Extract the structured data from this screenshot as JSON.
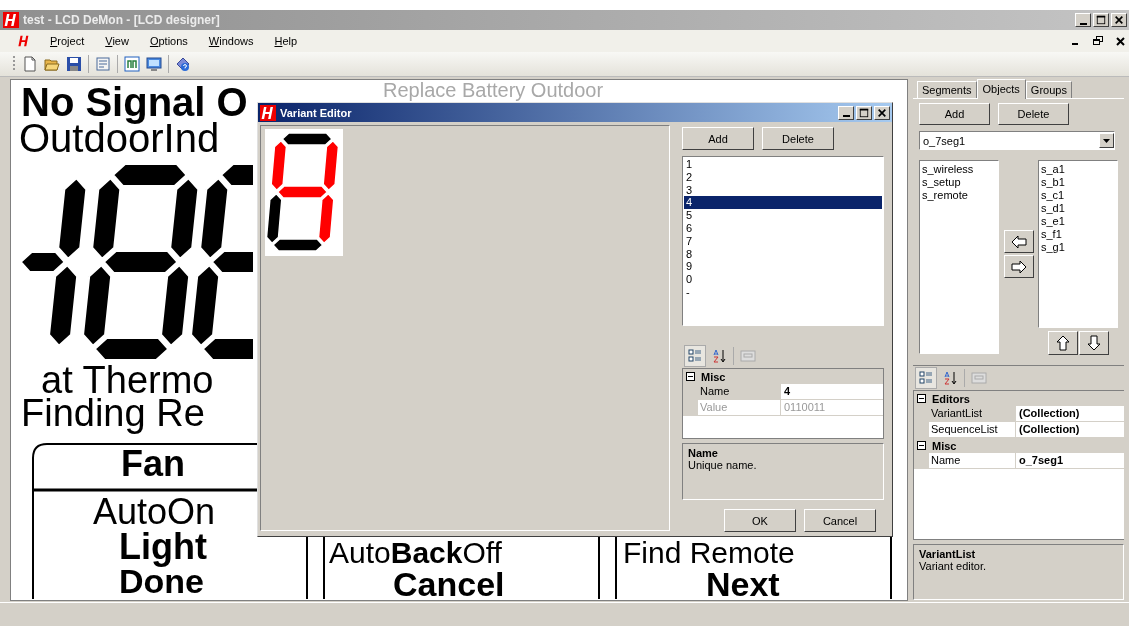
{
  "window": {
    "title": "test - LCD DeMon - [LCD designer]"
  },
  "menu": [
    {
      "label": "Project"
    },
    {
      "label": "View"
    },
    {
      "label": "Options"
    },
    {
      "label": "Windows"
    },
    {
      "label": "Help"
    }
  ],
  "canvas": {
    "texts": [
      {
        "text": "No Signal O",
        "kind": "bold"
      },
      {
        "text": "Replace Battery Outdoor",
        "kind": "faded"
      },
      {
        "text": "OutdoorInd",
        "kind": "plain"
      },
      {
        "text": "at Thermo",
        "kind": "plain"
      },
      {
        "text": "Finding Re",
        "kind": "plain"
      },
      {
        "text": "Fan",
        "kind": "bold"
      },
      {
        "text": "AutoOn",
        "kind": "plain"
      },
      {
        "text": "Light",
        "kind": "bold"
      },
      {
        "text": "Done",
        "kind": "bold"
      },
      {
        "text": "Auto**Back**Off",
        "kind": "plain"
      },
      {
        "text": "Cancel",
        "kind": "bold"
      },
      {
        "text": "Find Remote",
        "kind": "plain"
      },
      {
        "text": "Next",
        "kind": "bold"
      }
    ]
  },
  "variant_editor": {
    "title": "Variant Editor",
    "preview": {
      "segments_on": [
        false,
        true,
        true,
        false,
        false,
        true,
        true
      ]
    },
    "buttons": [
      "Add",
      "Delete"
    ],
    "variants": [
      {
        "label": "1",
        "selected": false
      },
      {
        "label": "2",
        "selected": false
      },
      {
        "label": "3",
        "selected": false
      },
      {
        "label": "4",
        "selected": true
      },
      {
        "label": "5",
        "selected": false
      },
      {
        "label": "6",
        "selected": false
      },
      {
        "label": "7",
        "selected": false
      },
      {
        "label": "8",
        "selected": false
      },
      {
        "label": "9",
        "selected": false
      },
      {
        "label": "0",
        "selected": false
      },
      {
        "label": "-",
        "selected": false
      }
    ],
    "properties": [
      {
        "category": "Misc",
        "rows": [
          {
            "name": "Name",
            "value": "4",
            "selected": true,
            "disabled": false
          },
          {
            "name": "Value",
            "value": "0110011",
            "selected": false,
            "disabled": true
          }
        ]
      }
    ],
    "help": {
      "title": "Name",
      "text": "Unique name."
    },
    "footer_buttons": [
      "OK",
      "Cancel"
    ]
  },
  "side_panel": {
    "tabs": [
      {
        "label": "Segments",
        "selected": false
      },
      {
        "label": "Objects",
        "selected": true
      },
      {
        "label": "Groups",
        "selected": false
      }
    ],
    "buttons": [
      "Add",
      "Delete"
    ],
    "object_select": "o_7seg1",
    "available": [
      "s_wireless",
      "s_setup",
      "s_remote"
    ],
    "assigned": [
      "s_a1",
      "s_b1",
      "s_c1",
      "s_d1",
      "s_e1",
      "s_f1",
      "s_g1"
    ],
    "properties": [
      {
        "category": "Editors",
        "rows": [
          {
            "name": "VariantList",
            "value": "(Collection)",
            "selected": true,
            "disabled": false
          },
          {
            "name": "SequenceList",
            "value": "(Collection)",
            "selected": false,
            "disabled": false
          }
        ]
      },
      {
        "category": "Misc",
        "rows": [
          {
            "name": "Name",
            "value": "o_7seg1",
            "selected": false,
            "disabled": false
          }
        ]
      }
    ],
    "help": {
      "title": "VariantList",
      "text": "Variant editor."
    }
  }
}
